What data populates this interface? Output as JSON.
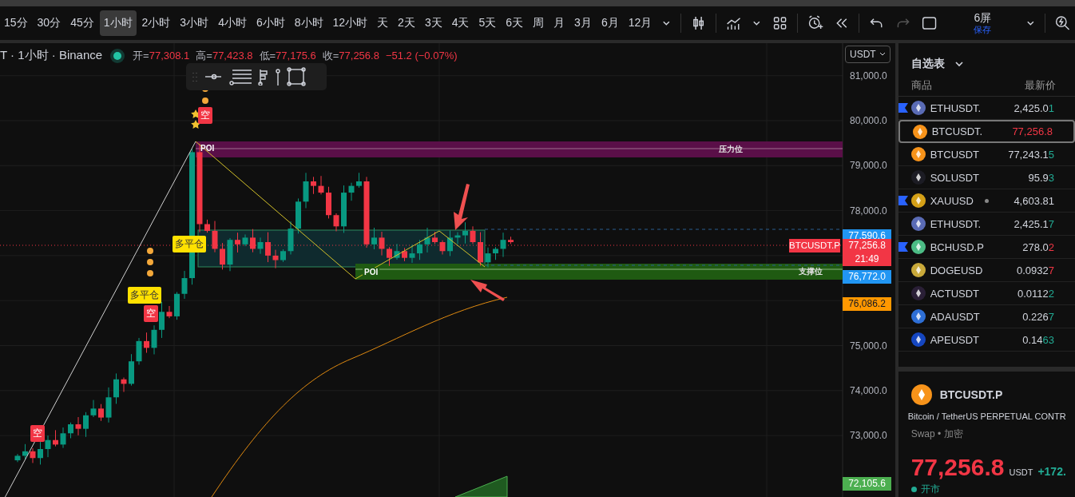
{
  "toolbar": {
    "intervals": [
      {
        "label": "15分",
        "selected": false
      },
      {
        "label": "30分",
        "selected": false
      },
      {
        "label": "45分",
        "selected": false
      },
      {
        "label": "1小时",
        "selected": true
      },
      {
        "label": "2小时",
        "selected": false
      },
      {
        "label": "3小时",
        "selected": false
      },
      {
        "label": "4小时",
        "selected": false
      },
      {
        "label": "6小时",
        "selected": false
      },
      {
        "label": "8小时",
        "selected": false
      },
      {
        "label": "12小时",
        "selected": false
      },
      {
        "label": "天",
        "selected": false
      },
      {
        "label": "2天",
        "selected": false
      },
      {
        "label": "3天",
        "selected": false
      },
      {
        "label": "4天",
        "selected": false
      },
      {
        "label": "5天",
        "selected": false
      },
      {
        "label": "6天",
        "selected": false
      },
      {
        "label": "周",
        "selected": false
      },
      {
        "label": "月",
        "selected": false
      },
      {
        "label": "3月",
        "selected": false
      },
      {
        "label": "6月",
        "selected": false
      },
      {
        "label": "12月",
        "selected": false
      }
    ],
    "layout_button": {
      "label": "6屏",
      "sublabel": "保存"
    }
  },
  "legend": {
    "title": "T · 1小时 · Binance",
    "values": [
      {
        "key": "开=",
        "value": "77,308.1"
      },
      {
        "key": "高=",
        "value": "77,423.8"
      },
      {
        "key": "低=",
        "value": "77,175.6"
      },
      {
        "key": "收=",
        "value": "77,256.8"
      }
    ],
    "change": "−51.2 (−0.07%)"
  },
  "currency": "USDT",
  "price_axis": [
    "81,000.0",
    "80,000.0",
    "79,000.0",
    "78,000.0",
    "75,000.0",
    "74,000.0",
    "73,000.0"
  ],
  "price_tags": [
    {
      "text": "77,590.6",
      "color": "#2196f3"
    },
    {
      "text": "77,256.8",
      "sub": "21:49",
      "symbol": "BTCUSDT.P",
      "color": "#f23645"
    },
    {
      "text": "76,772.0",
      "color": "#2196f3"
    },
    {
      "text": "76,086.2",
      "color": "#ff9800"
    },
    {
      "text": "72,105.6",
      "color": "#4caf50"
    }
  ],
  "zones": [
    {
      "label": "压力位",
      "kind": "resistance"
    },
    {
      "label": "支撑位",
      "kind": "support"
    }
  ],
  "poi_labels": [
    "POI",
    "POI"
  ],
  "signals": [
    {
      "text": "空",
      "kind": "short"
    },
    {
      "text": "空",
      "kind": "short"
    },
    {
      "text": "空",
      "kind": "short"
    },
    {
      "text": "多平仓",
      "kind": "close"
    },
    {
      "text": "多平仓",
      "kind": "close"
    }
  ],
  "watchlist": {
    "title": "自选表",
    "columns": [
      "商品",
      "最新价"
    ],
    "rows": [
      {
        "symbol": "ETHUSDT.",
        "price": "2,425.0",
        "last": "1",
        "rising": true,
        "color": "#5a6bb5",
        "flagged": true,
        "selected": false
      },
      {
        "symbol": "BTCUSDT.",
        "price": "77,256.8",
        "falling": true,
        "color": "#f7931a",
        "flagged": false,
        "selected": true
      },
      {
        "symbol": "BTCUSDT",
        "price": "77,243.1",
        "last": "5",
        "rising": true,
        "color": "#f7931a",
        "flagged": false,
        "selected": false
      },
      {
        "symbol": "SOLUSDT",
        "price": "95.9",
        "last": "3",
        "rising": true,
        "color": "#1c1c24",
        "flagged": false,
        "selected": false
      },
      {
        "symbol": "XAUUSD",
        "price": "4,603.81",
        "color": "#d4a017",
        "flagged": true,
        "selected": false,
        "dot": true
      },
      {
        "symbol": "ETHUSDT.",
        "price": "2,425.1",
        "last": "7",
        "rising": true,
        "color": "#5a6bb5",
        "flagged": false,
        "selected": false
      },
      {
        "symbol": "BCHUSD.P",
        "price": "278.0",
        "last": "2",
        "rising": false,
        "color": "#4cbc85",
        "flagged": true,
        "selected": false
      },
      {
        "symbol": "DOGEUSD",
        "price": "0.0932",
        "last": "7",
        "rising": false,
        "color": "#c9a93a",
        "flagged": false,
        "selected": false
      },
      {
        "symbol": "ACTUSDT",
        "price": "0.0112",
        "last": "2",
        "rising": true,
        "color": "#2a1f36",
        "flagged": false,
        "selected": false
      },
      {
        "symbol": "ADAUSDT",
        "price": "0.226",
        "last": "7",
        "rising": true,
        "color": "#2e6fd6",
        "flagged": false,
        "selected": false
      },
      {
        "symbol": "APEUSDT",
        "price": "0.14",
        "last": "63",
        "rising": true,
        "color": "#1546c0",
        "flagged": false,
        "selected": false
      }
    ]
  },
  "details": {
    "symbol": "BTCUSDT.P",
    "description": "Bitcoin / TetherUS PERPETUAL CONTR",
    "category": "Swap • 加密",
    "price": "77,256.8",
    "currency": "USDT",
    "change": "+172.",
    "status": "开市"
  }
}
